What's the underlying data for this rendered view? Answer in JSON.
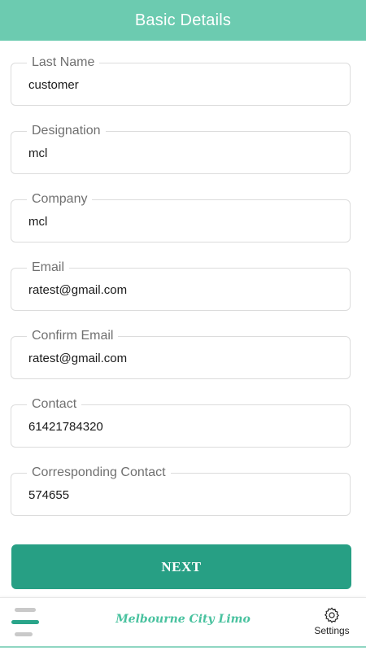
{
  "header": {
    "title": "Basic Details"
  },
  "fields": [
    {
      "label": "Last Name",
      "value": "customer"
    },
    {
      "label": "Designation",
      "value": "mcl"
    },
    {
      "label": "Company",
      "value": "mcl"
    },
    {
      "label": "Email",
      "value": "ratest@gmail.com"
    },
    {
      "label": "Confirm Email",
      "value": "ratest@gmail.com"
    },
    {
      "label": "Contact",
      "value": "61421784320"
    },
    {
      "label": "Corresponding Contact",
      "value": "574655"
    }
  ],
  "actions": {
    "next_label": "NEXT"
  },
  "bottom_bar": {
    "brand": "Melbourne City Limo",
    "settings_label": "Settings",
    "menu_icon": "hamburger-menu-icon",
    "settings_icon": "gear-icon"
  },
  "colors": {
    "header_bg": "#6ccbb0",
    "button_bg": "#279f84",
    "brand_text": "#49c29f"
  }
}
